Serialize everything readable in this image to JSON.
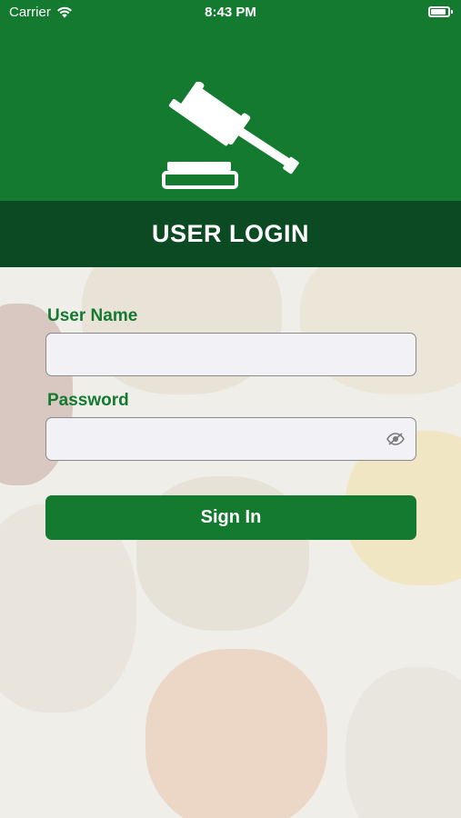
{
  "status_bar": {
    "carrier": "Carrier",
    "time": "8:43 PM"
  },
  "header": {
    "logo_icon": "gavel-icon",
    "title": "USER LOGIN"
  },
  "form": {
    "username_label": "User Name",
    "username_value": "",
    "password_label": "Password",
    "password_value": "",
    "password_toggle_icon": "eye-slash-icon",
    "sign_in_label": "Sign In"
  },
  "colors": {
    "primary": "#137a30",
    "title_bar": "#0b4a22"
  }
}
